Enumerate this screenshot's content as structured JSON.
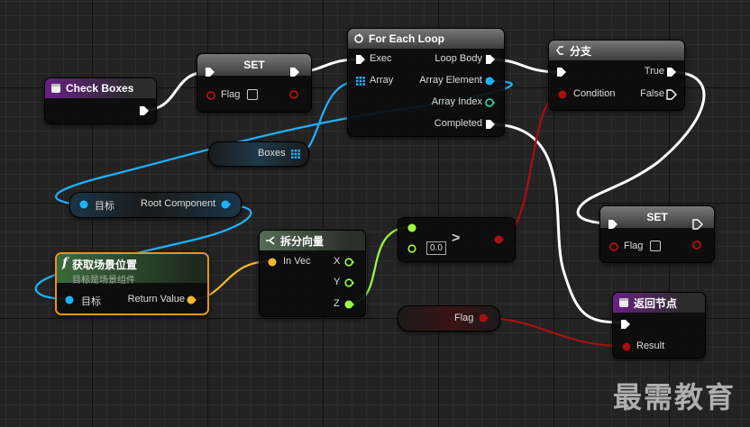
{
  "colors": {
    "exec": "#ffffff",
    "object": "#1eb3ff",
    "vector": "#f5b82b",
    "float": "#9cff40",
    "boolean": "#ab1010",
    "selected": "#e8941a"
  },
  "nodes": {
    "check_boxes": {
      "title": "Check Boxes",
      "icon": "event-icon"
    },
    "set1": {
      "title": "SET",
      "flag_label": "Flag"
    },
    "for_each": {
      "title": "For Each Loop",
      "exec_label": "Exec",
      "array_label": "Array",
      "loop_body_label": "Loop Body",
      "array_element_label": "Array Element",
      "array_index_label": "Array Index",
      "completed_label": "Completed",
      "icon": "loop-icon"
    },
    "branch": {
      "title": "分支",
      "condition_label": "Condition",
      "true_label": "True",
      "false_label": "False",
      "icon": "branch-icon"
    },
    "boxes_var": {
      "label": "Boxes"
    },
    "root_component": {
      "target_label": "目标",
      "output_label": "Root Component"
    },
    "get_location": {
      "title": "获取场景位置",
      "subtitle": "目标是场景组件",
      "target_label": "目标",
      "return_label": "Return Value",
      "icon": "function-icon"
    },
    "break_vector": {
      "title": "拆分向量",
      "in_label": "In Vec",
      "x_label": "X",
      "y_label": "Y",
      "z_label": "Z",
      "icon": "break-vector-icon"
    },
    "compare": {
      "symbol": ">",
      "value": "0.0"
    },
    "set2": {
      "title": "SET",
      "flag_label": "Flag"
    },
    "flag_var": {
      "label": "Flag"
    },
    "return_node": {
      "title": "返回节点",
      "result_label": "Result",
      "icon": "return-icon"
    }
  },
  "watermark": "最需教育"
}
